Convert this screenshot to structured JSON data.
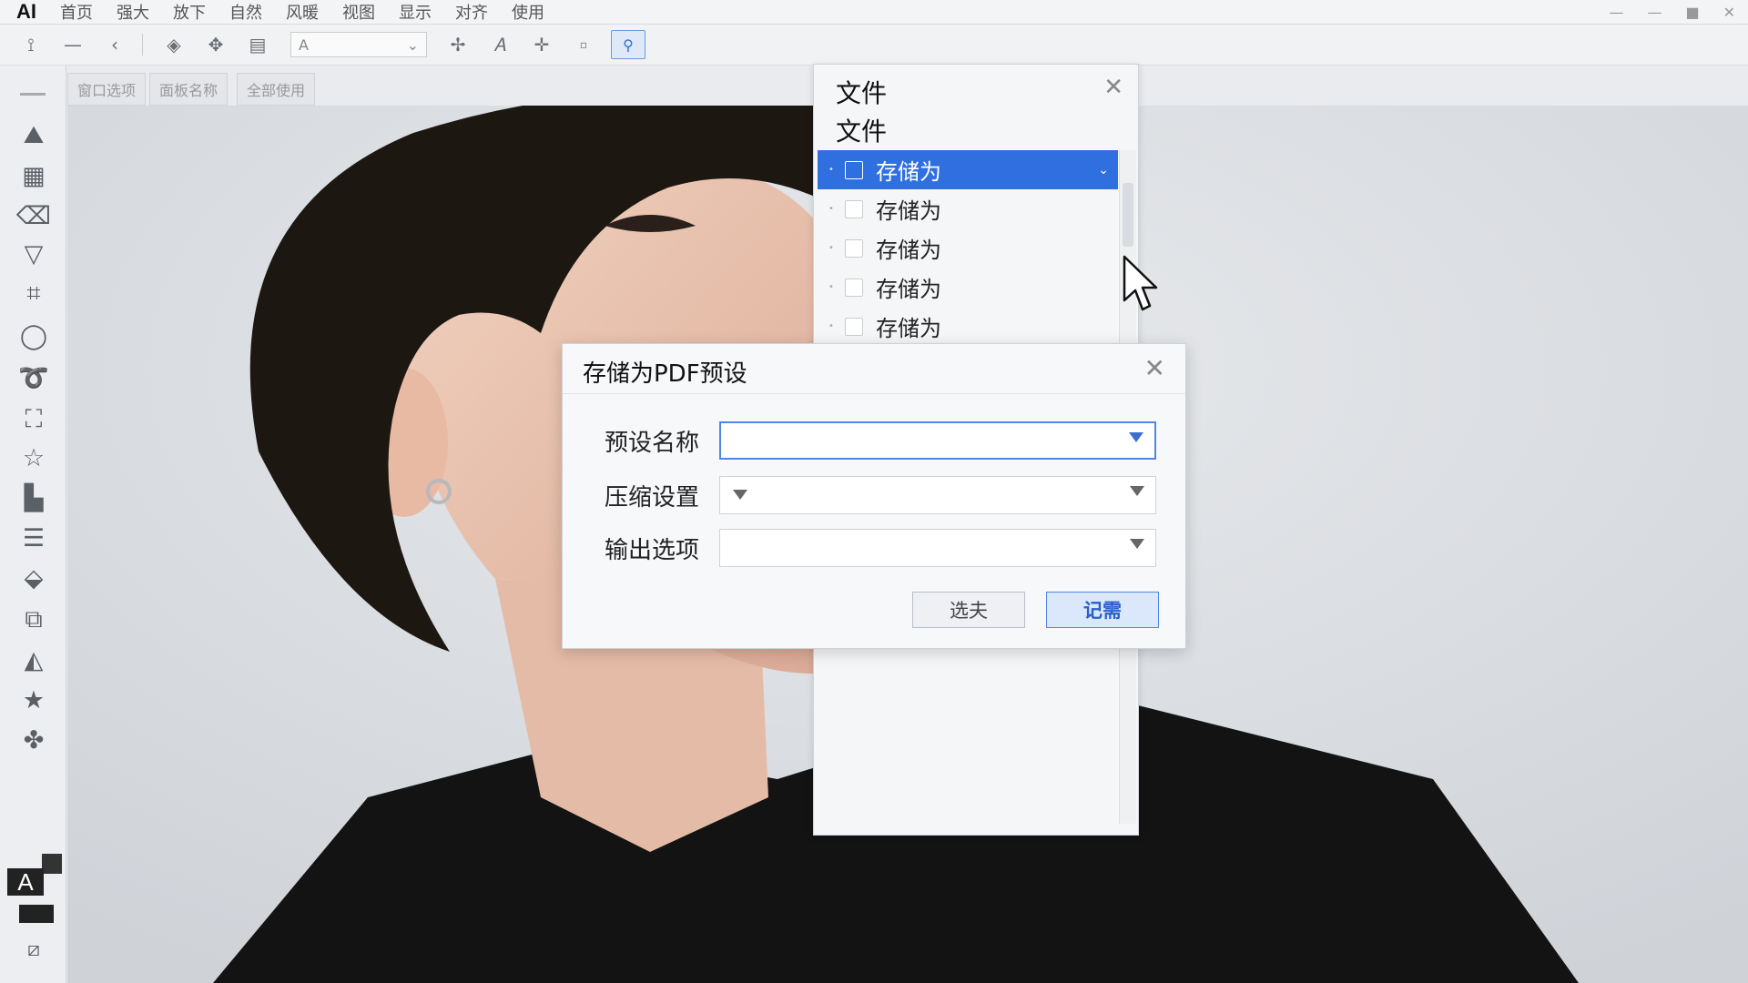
{
  "app": {
    "logo": "AI"
  },
  "menubar": {
    "items": [
      "首页",
      "强大",
      "放下",
      "自然",
      "风暖",
      "视图",
      "显示",
      "对齐",
      "使用"
    ],
    "window_controls": [
      "—",
      "—",
      "■",
      "✕"
    ]
  },
  "toolbar": {
    "font_select_value": "A"
  },
  "document_tabs": [
    "窗口选项",
    "面板名称",
    "全部使用"
  ],
  "file_panel": {
    "title": "文件",
    "subtitle": "文件",
    "items": [
      {
        "label": "存储为",
        "selected": true
      },
      {
        "label": "存储为",
        "selected": false
      },
      {
        "label": "存储为",
        "selected": false
      },
      {
        "label": "存储为",
        "selected": false
      },
      {
        "label": "存储为",
        "selected": false
      }
    ]
  },
  "dialog": {
    "title": "存储为PDF预设",
    "fields": [
      {
        "label": "预设名称",
        "value": ""
      },
      {
        "label": "压缩设置",
        "value": ""
      },
      {
        "label": "输出选项",
        "value": ""
      }
    ],
    "cancel_label": "选夫",
    "ok_label": "记需"
  },
  "colors": {
    "selection_blue": "#2f6fe0",
    "focus_blue": "#4f86e8",
    "canvas_bg": "#dde0e5"
  }
}
